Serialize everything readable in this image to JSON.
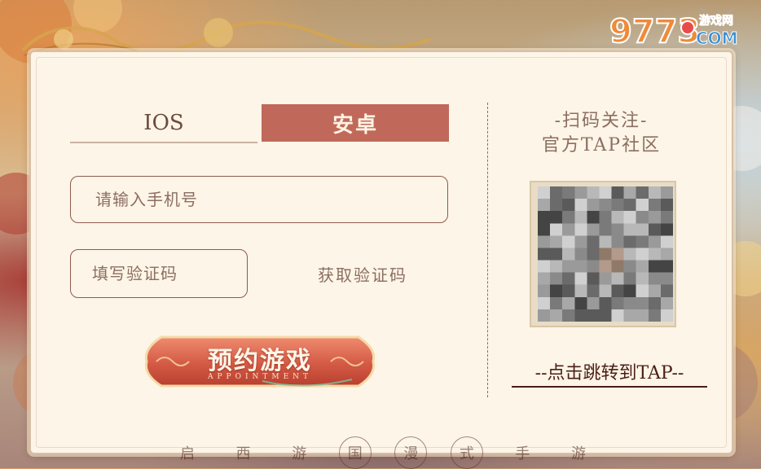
{
  "watermark": {
    "brand_icon": "9773-youxiwang-logo-icon"
  },
  "tabs": [
    {
      "label": "IOS",
      "active": false
    },
    {
      "label": "安卓",
      "active": true
    }
  ],
  "form": {
    "phone_placeholder": "请输入手机号",
    "phone_value": "",
    "code_placeholder": "填写验证码",
    "code_value": "",
    "get_code_label": "获取验证码",
    "appointment_label": "预约游戏",
    "appointment_sub": "APPOINTMENT"
  },
  "qr": {
    "title_line1": "-扫码关注-",
    "title_line2": "官方TAP社区",
    "icon": "qr-code-icon",
    "link_label": "--点击跳转到TAP--"
  },
  "bottom_chars": [
    "启",
    "西",
    "游",
    "国",
    "漫",
    "式",
    "手",
    "游"
  ],
  "colors": {
    "accent": "#c0695a",
    "panel": "#fdf5e7",
    "text": "#8c6e62",
    "dark_text": "#4a1e16"
  }
}
